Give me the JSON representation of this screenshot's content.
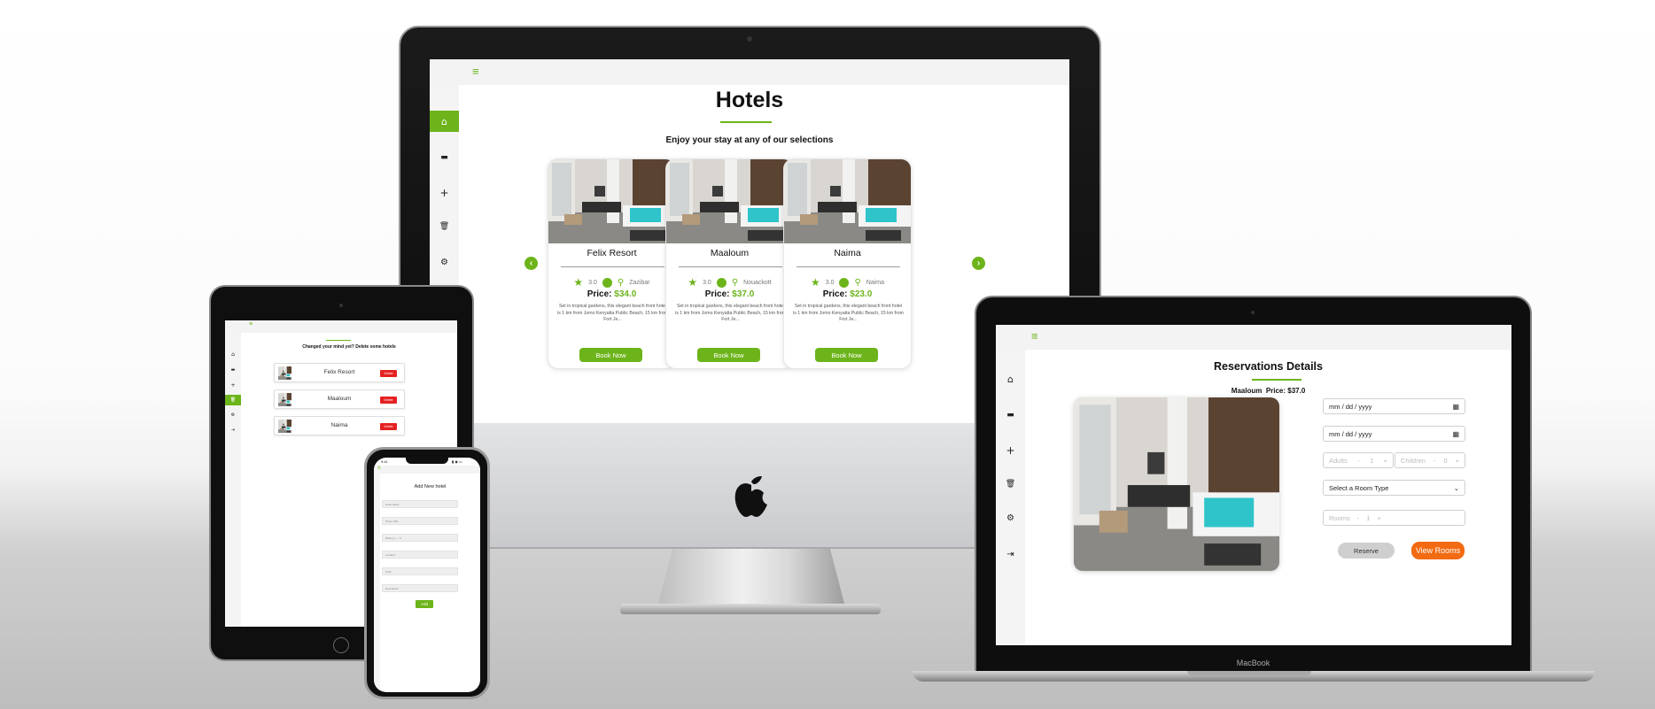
{
  "imac": {
    "app": {
      "menu_icon": "hamburger-menu-icon",
      "sidebar": [
        {
          "icon": "home-icon",
          "glyph": "⌂",
          "active": true
        },
        {
          "icon": "bed-icon",
          "glyph": "▬",
          "active": false
        },
        {
          "icon": "plus-icon",
          "glyph": "+",
          "active": false
        },
        {
          "icon": "trash-icon",
          "glyph": "🗑",
          "active": false
        },
        {
          "icon": "settings-icon",
          "glyph": "⚙",
          "active": false
        }
      ],
      "title": "Hotels",
      "subtitle": "Enjoy your stay at any of our selections",
      "prev_icon": "‹",
      "next_icon": "›",
      "hotels": [
        {
          "name": "Felix Resort",
          "rating": "3.0",
          "location": "Zazibar",
          "price_label": "Price:",
          "price": "$34.0",
          "description": "Set in tropical gardens, this elegant beach front hotel is 1 km from Jomo Kenyatta Public Beach, 15 km from Fort Je...",
          "button": "Book Now"
        },
        {
          "name": "Maaloum",
          "rating": "3.0",
          "location": "Nouackott",
          "price_label": "Price:",
          "price": "$37.0",
          "description": "Set in tropical gardens, this elegant beach front hotel is 1 km from Jomo Kenyatta Public Beach, 15 km from Fort Je...",
          "button": "Book Now"
        },
        {
          "name": "Naima",
          "rating": "3.0",
          "location": "Naima",
          "price_label": "Price:",
          "price": "$23.0",
          "description": "Set in tropical gardens, this elegant beach front hotel is 1 km from Jomo Kenyatta Public Beach, 15 km from Fort Je...",
          "button": "Book Now"
        }
      ]
    }
  },
  "tablet": {
    "heading": "Changed your mind yet? Delete some hotels",
    "rows": [
      {
        "name": "Felix Resort",
        "button": "Delete"
      },
      {
        "name": "Maaloum",
        "button": "Delete"
      },
      {
        "name": "Naima",
        "button": "Delete"
      }
    ]
  },
  "phone": {
    "status_time": "9:41",
    "title": "Add New hotel",
    "fields": [
      "Hotel Name",
      "Photo URL",
      "Rating  1 — 5",
      "Location",
      "Price",
      "Description"
    ],
    "button": "Add"
  },
  "macbook": {
    "brand": "MacBook",
    "app": {
      "title": "Reservations Details",
      "hotel": "Maaloum",
      "price_label": "Price:",
      "price": "$37.0",
      "date_placeholder_1": "mm / dd / yyyy",
      "date_placeholder_2": "mm / dd / yyyy",
      "adults_label": "Adults",
      "adults_value": "1",
      "children_label": "Children",
      "children_value": "0",
      "room_type": "Select a Room Type",
      "rooms_label": "Rooms",
      "rooms_value": "1",
      "minus": "-",
      "plus": "+",
      "reserve_button": "Reserve",
      "view_rooms_button": "View Rooms",
      "sidebar": [
        "home-icon",
        "bed-icon",
        "plus-icon",
        "trash-icon",
        "settings-icon",
        "logout-icon"
      ]
    }
  },
  "colors": {
    "accent": "#6cb41a",
    "delete": "#e52020",
    "view_rooms": "#f26a12"
  }
}
